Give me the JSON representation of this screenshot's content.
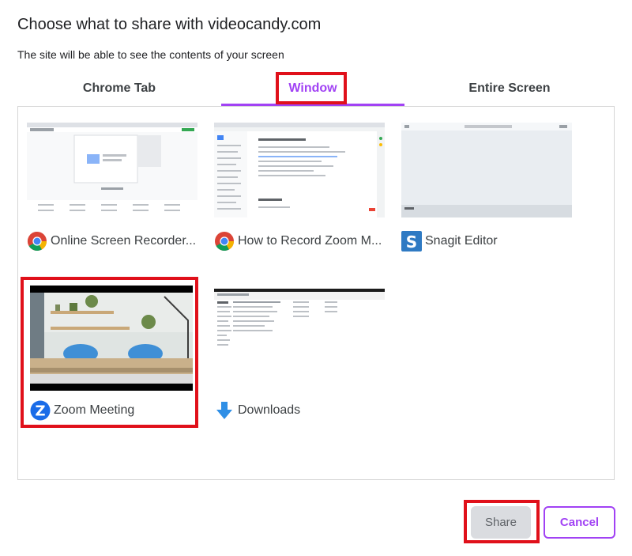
{
  "dialog": {
    "title": "Choose what to share with videocandy.com",
    "subtitle": "The site will be able to see the contents of your screen"
  },
  "tabs": [
    {
      "label": "Chrome Tab",
      "selected": false
    },
    {
      "label": "Window",
      "selected": true
    },
    {
      "label": "Entire Screen",
      "selected": false
    }
  ],
  "windows": [
    {
      "label": "Online Screen Recorder...",
      "icon": "chrome-icon"
    },
    {
      "label": "How to Record Zoom M...",
      "icon": "chrome-icon"
    },
    {
      "label": "Snagit Editor",
      "icon": "snagit-icon"
    },
    {
      "label": "Zoom Meeting",
      "icon": "zoom-icon"
    },
    {
      "label": "Downloads",
      "icon": "download-arrow-icon"
    }
  ],
  "buttons": {
    "share": "Share",
    "cancel": "Cancel"
  },
  "colors": {
    "accent": "#a142f4",
    "highlight": "#e0101a"
  }
}
